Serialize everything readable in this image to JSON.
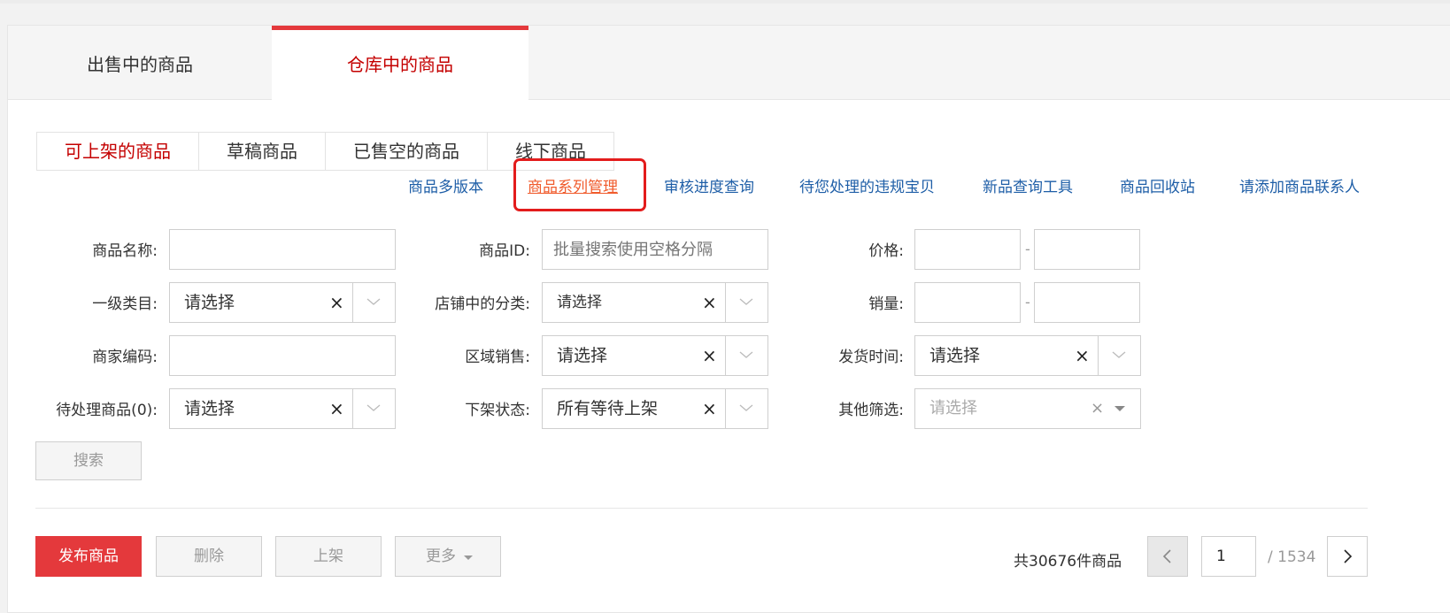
{
  "tabs": {
    "on_sale": "出售中的商品",
    "in_warehouse": "仓库中的商品"
  },
  "subtabs": {
    "listable": "可上架的商品",
    "drafts": "草稿商品",
    "sold_out": "已售空的商品",
    "offline": "线下商品"
  },
  "links": {
    "multi_version": "商品多版本",
    "series_mgmt": "商品系列管理",
    "review_progress": "审核进度查询",
    "violations": "待您处理的违规宝贝",
    "new_item_tool": "新品查询工具",
    "recycle_bin": "商品回收站",
    "add_contact": "请添加商品联系人"
  },
  "form": {
    "name_label": "商品名称:",
    "id_label": "商品ID:",
    "id_placeholder": "批量搜索使用空格分隔",
    "price_label": "价格:",
    "category_label": "一级类目:",
    "category_value": "请选择",
    "shop_category_label": "店铺中的分类:",
    "shop_category_value": "请选择",
    "sales_label": "销量:",
    "merchant_code_label": "商家编码:",
    "region_label": "区域销售:",
    "region_value": "请选择",
    "ship_time_label": "发货时间:",
    "ship_time_value": "请选择",
    "pending_label": "待处理商品(0):",
    "pending_value": "请选择",
    "delist_label": "下架状态:",
    "delist_value": "所有等待上架",
    "other_label": "其他筛选:",
    "other_value": "请选择",
    "range_sep": "-",
    "clear_symbol": "×",
    "search_button": "搜索"
  },
  "actions": {
    "publish": "发布商品",
    "delete": "删除",
    "list": "上架",
    "more": "更多"
  },
  "pagination": {
    "total_text": "共30676件商品",
    "current_page": "1",
    "total_pages": "/ 1534"
  },
  "colors": {
    "accent_red": "#e4393c",
    "active_tab_text": "#c40000",
    "link_blue": "#1e5ea7",
    "highlight_link": "#f05b2c",
    "highlight_box": "#e31c1c"
  },
  "icons": [
    "clear-icon",
    "chevron-down-icon",
    "caret-down-icon",
    "chevron-left-icon",
    "chevron-right-icon"
  ]
}
